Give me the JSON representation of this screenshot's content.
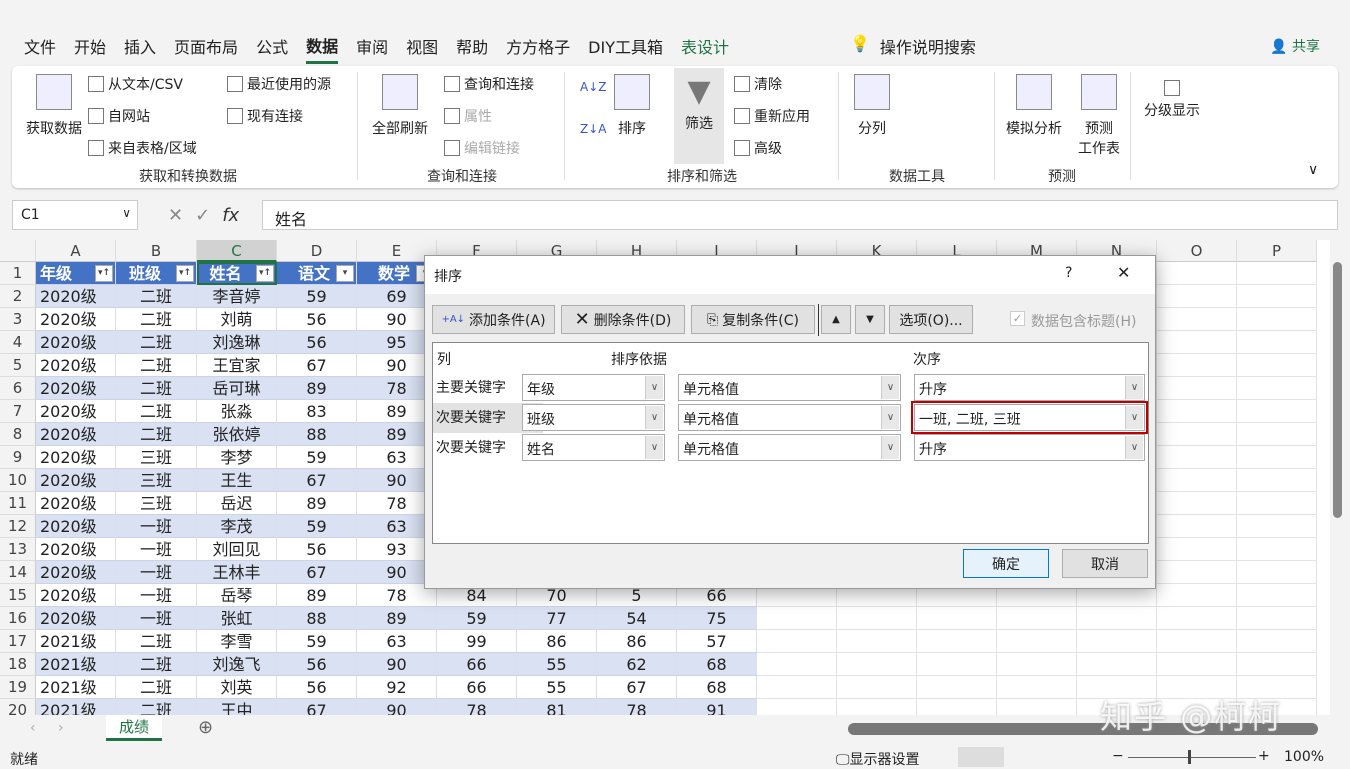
{
  "menu": {
    "items": [
      "文件",
      "开始",
      "插入",
      "页面布局",
      "公式",
      "数据",
      "审阅",
      "视图",
      "帮助",
      "方方格子",
      "DIY工具箱",
      "表设计"
    ],
    "active": "数据",
    "search": "操作说明搜索",
    "share": "共享"
  },
  "ribbon": {
    "get_data": "获取数据",
    "from_text": "从文本/CSV",
    "recent_sources": "最近使用的源",
    "from_web": "自网站",
    "existing_conn": "现有连接",
    "from_table": "来自表格/区域",
    "group1": "获取和转换数据",
    "refresh_all": "全部刷新",
    "queries_conn": "查询和连接",
    "properties": "属性",
    "edit_links": "编辑链接",
    "group2": "查询和连接",
    "sort": "排序",
    "filter": "筛选",
    "clear": "清除",
    "reapply": "重新应用",
    "advanced": "高级",
    "group3": "排序和筛选",
    "text_to_columns": "分列",
    "group4": "数据工具",
    "what_if": "模拟分析",
    "forecast_sheet": "预测\n工作表",
    "group5": "预测",
    "outline": "分级显示"
  },
  "formula_bar": {
    "name_box": "C1",
    "formula": "姓名"
  },
  "grid": {
    "columns": [
      "A",
      "B",
      "C",
      "D",
      "E",
      "F",
      "G",
      "H",
      "I",
      "J",
      "K",
      "L",
      "M",
      "N",
      "O",
      "P"
    ],
    "headers": [
      "年级",
      "班级",
      "姓名",
      "语文",
      "数学"
    ],
    "rows": [
      [
        "2020级",
        "二班",
        "李音婷",
        "59",
        "69",
        "",
        "",
        "",
        ""
      ],
      [
        "2020级",
        "二班",
        "刘萌",
        "56",
        "90",
        "",
        "",
        "",
        ""
      ],
      [
        "2020级",
        "二班",
        "刘逸琳",
        "56",
        "95",
        "",
        "",
        "",
        ""
      ],
      [
        "2020级",
        "二班",
        "王宜家",
        "67",
        "90",
        "",
        "",
        "",
        ""
      ],
      [
        "2020级",
        "二班",
        "岳可琳",
        "89",
        "78",
        "",
        "",
        "",
        ""
      ],
      [
        "2020级",
        "二班",
        "张淼",
        "83",
        "89",
        "",
        "",
        "",
        ""
      ],
      [
        "2020级",
        "二班",
        "张依婷",
        "88",
        "89",
        "",
        "",
        "",
        ""
      ],
      [
        "2020级",
        "三班",
        "李梦",
        "59",
        "63",
        "",
        "",
        "",
        ""
      ],
      [
        "2020级",
        "三班",
        "王生",
        "67",
        "90",
        "",
        "",
        "",
        ""
      ],
      [
        "2020级",
        "三班",
        "岳迟",
        "89",
        "78",
        "",
        "",
        "",
        ""
      ],
      [
        "2020级",
        "一班",
        "李茂",
        "59",
        "63",
        "",
        "",
        "",
        ""
      ],
      [
        "2020级",
        "一班",
        "刘回见",
        "56",
        "93",
        "",
        "",
        "",
        ""
      ],
      [
        "2020级",
        "一班",
        "王林丰",
        "67",
        "90",
        "",
        "",
        "",
        ""
      ],
      [
        "2020级",
        "一班",
        "岳琴",
        "89",
        "78",
        "84",
        "70",
        "5",
        "66"
      ],
      [
        "2020级",
        "一班",
        "张虹",
        "88",
        "89",
        "59",
        "77",
        "54",
        "75"
      ],
      [
        "2021级",
        "二班",
        "李雪",
        "59",
        "63",
        "99",
        "86",
        "86",
        "57"
      ],
      [
        "2021级",
        "二班",
        "刘逸飞",
        "56",
        "90",
        "66",
        "55",
        "62",
        "68"
      ],
      [
        "2021级",
        "二班",
        "刘英",
        "56",
        "92",
        "66",
        "55",
        "67",
        "68"
      ],
      [
        "2021级",
        "二班",
        "王中",
        "67",
        "90",
        "78",
        "81",
        "78",
        "91"
      ]
    ]
  },
  "sheet": {
    "tab": "成绩"
  },
  "status": {
    "ready": "就绪",
    "display_settings": "显示器设置",
    "zoom": "100%"
  },
  "watermark": "知乎 @柯柯",
  "dialog": {
    "title": "排序",
    "help": "?",
    "close": "✕",
    "add": "添加条件(A)",
    "delete": "删除条件(D)",
    "copy": "复制条件(C)",
    "options": "选项(O)...",
    "has_headers": "数据包含标题(H)",
    "has_headers_checked": true,
    "col_header": "列",
    "sort_on_header": "排序依据",
    "order_header": "次序",
    "levels": [
      {
        "label": "主要关键字",
        "column": "年级",
        "sort_on": "单元格值",
        "order": "升序"
      },
      {
        "label": "次要关键字",
        "column": "班级",
        "sort_on": "单元格值",
        "order": "一班, 二班, 三班"
      },
      {
        "label": "次要关键字",
        "column": "姓名",
        "sort_on": "单元格值",
        "order": "升序"
      }
    ],
    "ok": "确定",
    "cancel": "取消",
    "highlight_color": "#c00000"
  },
  "colors": {
    "table_header": "#4472c4",
    "band": "#d9e1f2",
    "excel_green": "#217346"
  }
}
